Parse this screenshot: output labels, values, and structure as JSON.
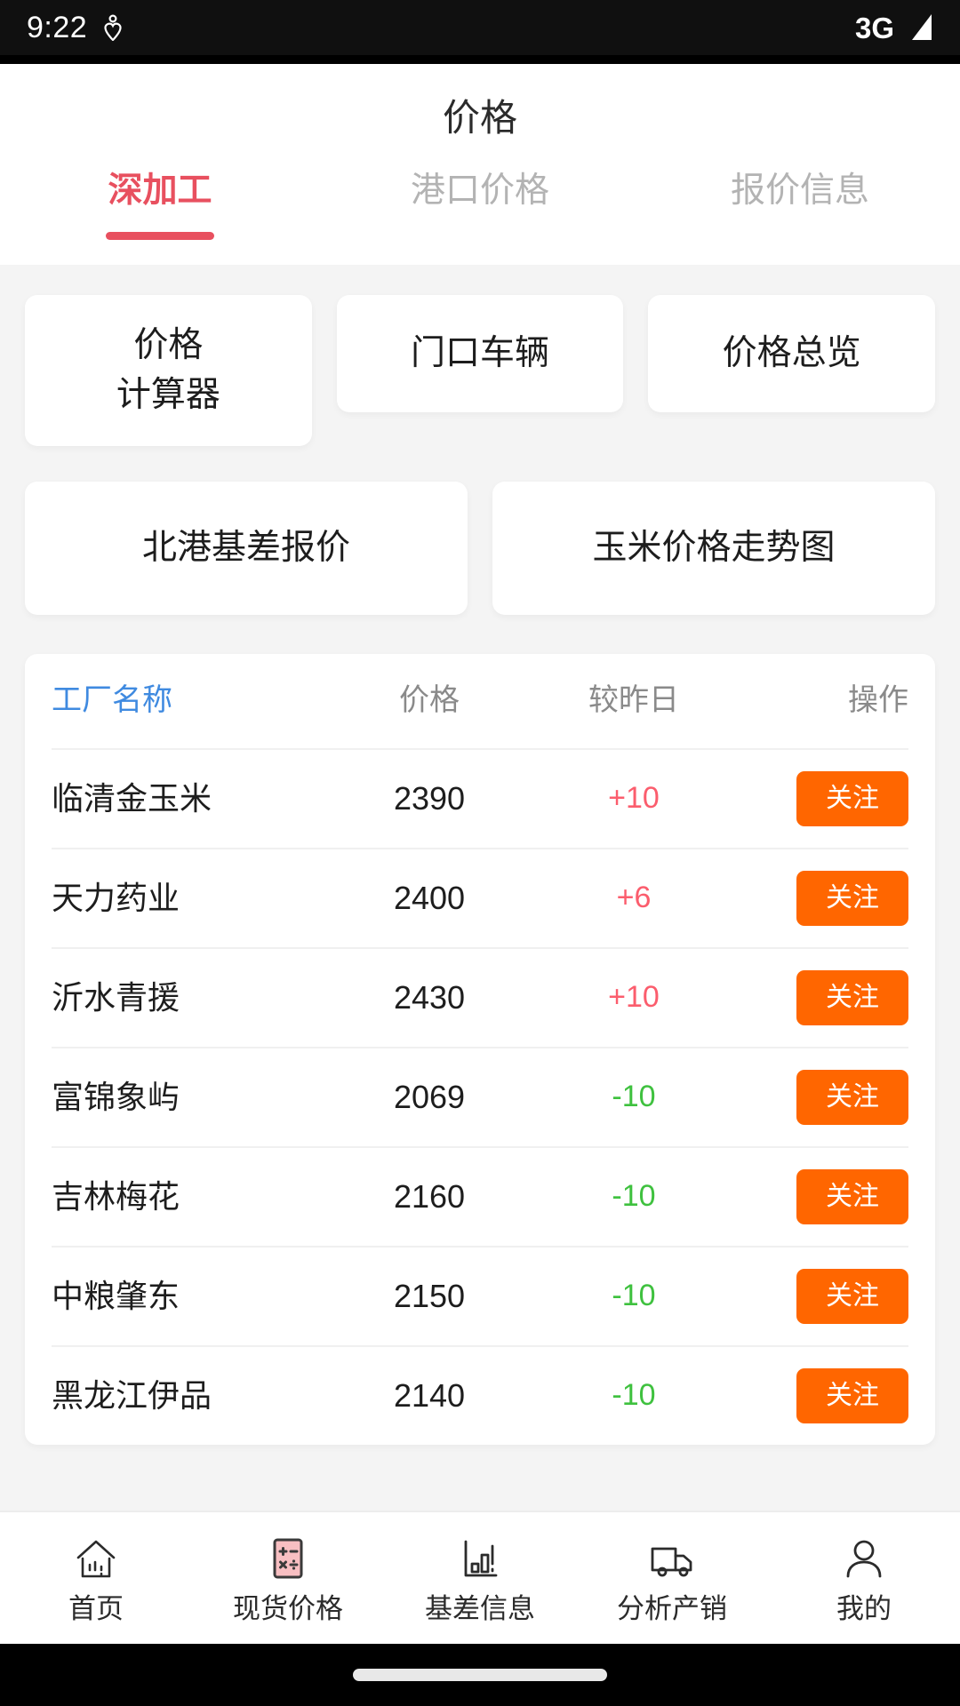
{
  "status_bar": {
    "time": "9:22",
    "left_icon": "heart-pin-icon",
    "network": "3G",
    "right_icon": "signal-triangle-icon"
  },
  "header": {
    "title": "价格"
  },
  "tabs": [
    {
      "label": "深加工",
      "active": true
    },
    {
      "label": "港口价格",
      "active": false
    },
    {
      "label": "报价信息",
      "active": false
    }
  ],
  "shortcuts": {
    "row1": [
      {
        "label": "价格\n计算器"
      },
      {
        "label": "门口车辆"
      },
      {
        "label": "价格总览"
      }
    ],
    "row2": [
      {
        "label": "北港基差报价"
      },
      {
        "label": "玉米价格走势图"
      }
    ]
  },
  "table": {
    "headers": {
      "name": "工厂名称",
      "price": "价格",
      "change": "较昨日",
      "action": "操作"
    },
    "action_label": "关注",
    "rows": [
      {
        "name": "临清金玉米",
        "price": "2390",
        "change": "+10",
        "direction": "up",
        "action": "关注"
      },
      {
        "name": "天力药业",
        "price": "2400",
        "change": "+6",
        "direction": "up",
        "action": "关注"
      },
      {
        "name": "沂水青援",
        "price": "2430",
        "change": "+10",
        "direction": "up",
        "action": "关注"
      },
      {
        "name": "富锦象屿",
        "price": "2069",
        "change": "-10",
        "direction": "down",
        "action": "关注"
      },
      {
        "name": "吉林梅花",
        "price": "2160",
        "change": "-10",
        "direction": "down",
        "action": "关注"
      },
      {
        "name": "中粮肇东",
        "price": "2150",
        "change": "-10",
        "direction": "down",
        "action": "关注"
      },
      {
        "name": "黑龙江伊品",
        "price": "2140",
        "change": "-10",
        "direction": "down",
        "action": "关注"
      }
    ]
  },
  "bottom_nav": [
    {
      "label": "首页",
      "icon": "home-icon"
    },
    {
      "label": "现货价格",
      "icon": "calculator-icon"
    },
    {
      "label": "基差信息",
      "icon": "bar-chart-icon"
    },
    {
      "label": "分析产销",
      "icon": "truck-icon"
    },
    {
      "label": "我的",
      "icon": "person-icon"
    }
  ],
  "colors": {
    "accent_red": "#e8505f",
    "up_red": "#fb5d6d",
    "down_green": "#3fc13f",
    "button_orange": "#ff6600",
    "header_link_blue": "#3f8ae0",
    "page_bg": "#f4f4f4"
  }
}
